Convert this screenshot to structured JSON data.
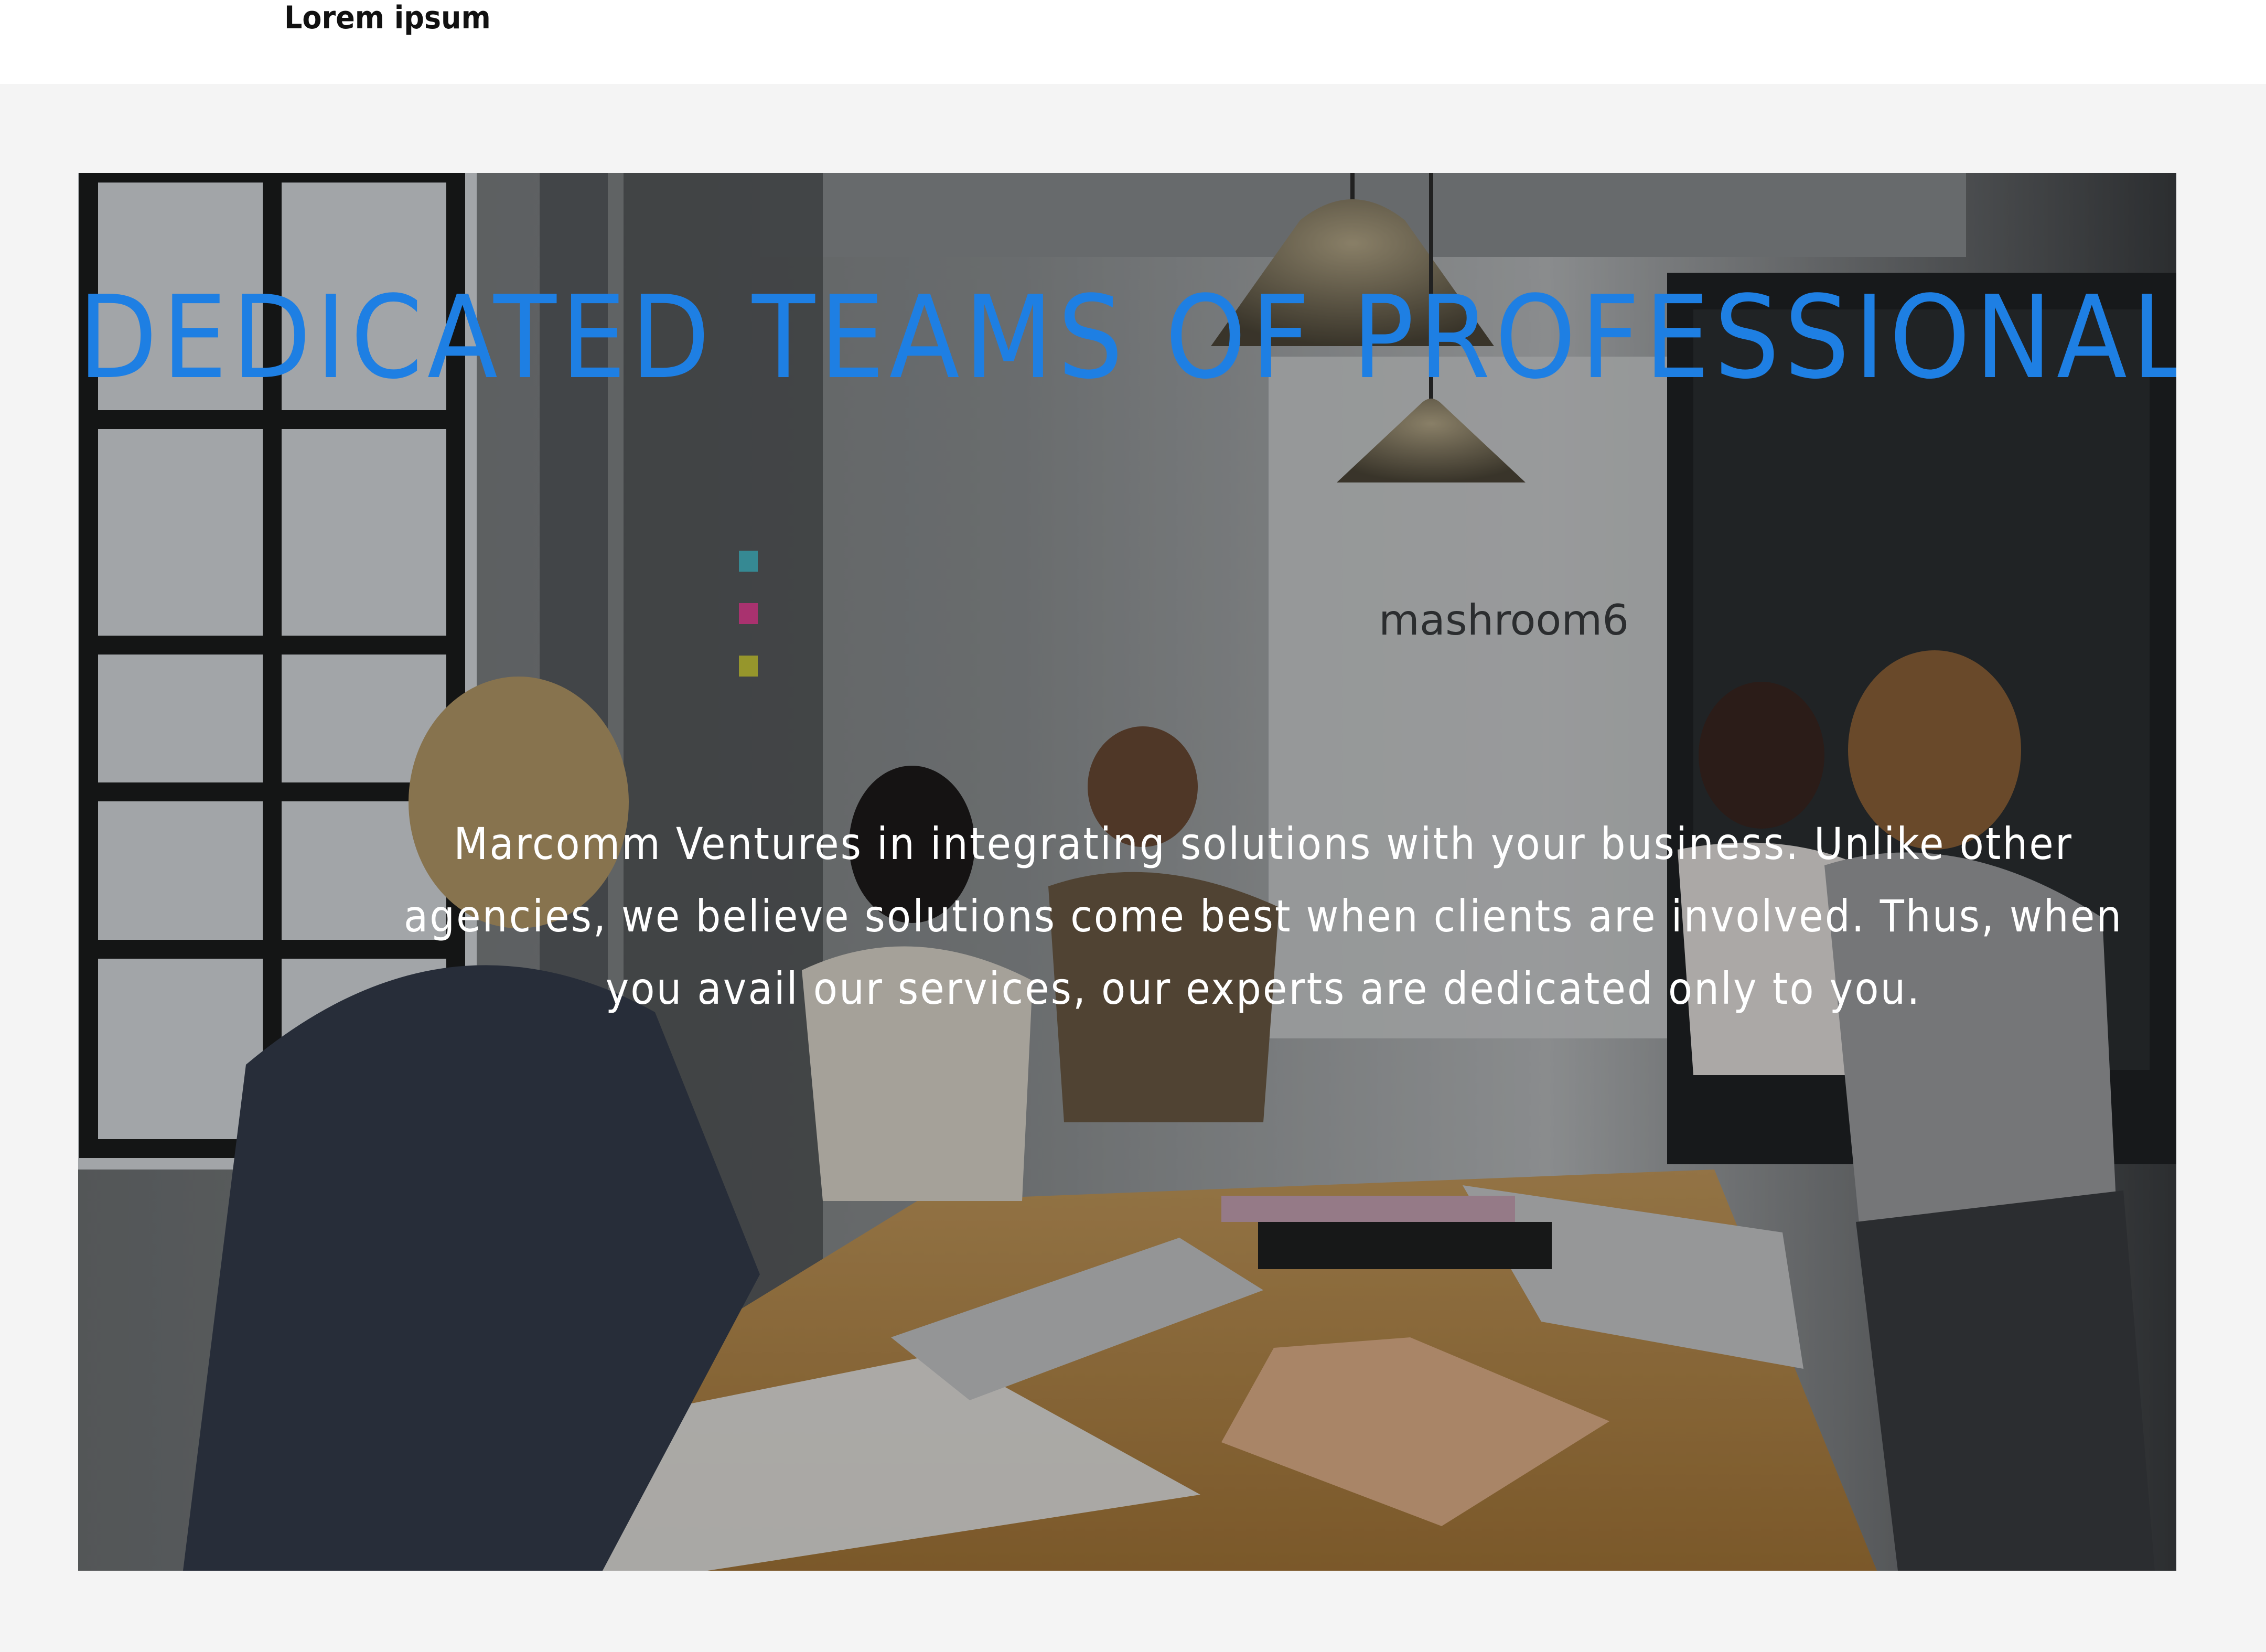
{
  "header": {
    "label": "Lorem ipsum"
  },
  "hero": {
    "title": "DEDICATED TEAMS OF PROFESSIONALS",
    "body": "Marcomm Ventures in integrating solutions with your business. Unlike other agencies, we believe solutions come best when clients are involved. Thus, when you avail our services, our experts are dedicated only to you.",
    "wall_sign": "mashroom6"
  },
  "colors": {
    "title": "#1e7fe3",
    "body_text": "#ffffff",
    "section_bg": "#f4f4f4",
    "header_bg": "#ffffff"
  }
}
